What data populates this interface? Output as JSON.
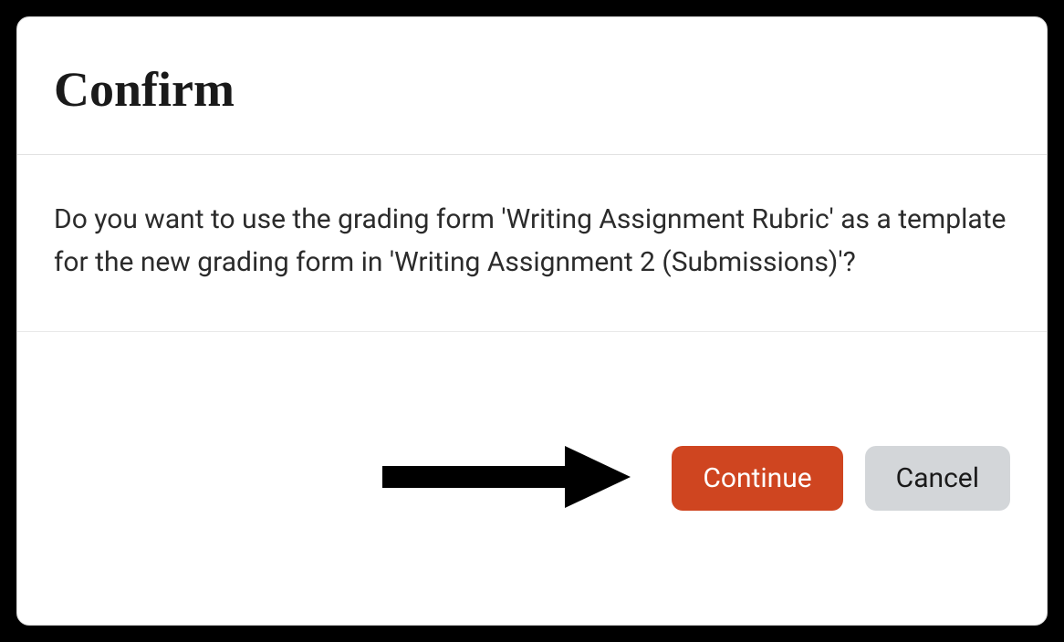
{
  "dialog": {
    "title": "Confirm",
    "message": "Do you want to use the grading form 'Writing Assignment Rubric' as a template for the new grading form in 'Writing Assignment 2 (Submissions)'?",
    "buttons": {
      "continue": "Continue",
      "cancel": "Cancel"
    }
  }
}
